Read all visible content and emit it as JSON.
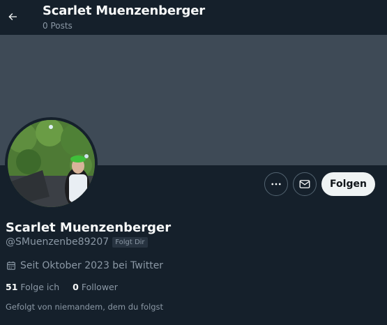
{
  "header": {
    "name": "Scarlet Muenzenberger",
    "posts": "0 Posts",
    "back_icon": "arrow-left-icon"
  },
  "profile": {
    "name": "Scarlet Muenzenberger",
    "handle": "@SMuenzenbe89207",
    "follows_you_badge": "Folgt Dir",
    "joined": "Seit Oktober 2023 bei Twitter",
    "following_count": "51",
    "following_label": "Folge ich",
    "followers_count": "0",
    "followers_label": "Follower",
    "followed_by": "Gefolgt von niemandem, dem du folgst"
  },
  "actions": {
    "follow_label": "Folgen",
    "more_icon": "more-horizontal-icon",
    "message_icon": "envelope-icon"
  },
  "colors": {
    "background": "#15202b",
    "banner": "#3e4a56",
    "secondary_text": "#8b98a5",
    "follow_button_bg": "#eff3f4"
  }
}
